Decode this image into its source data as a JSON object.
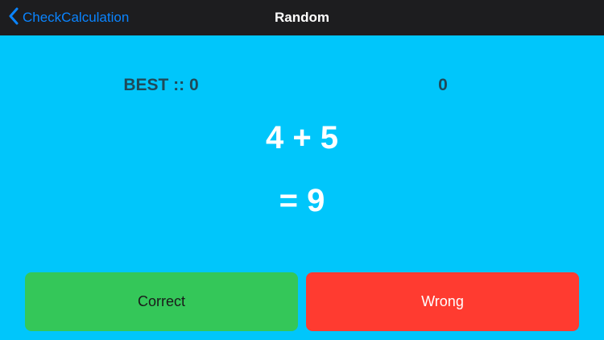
{
  "nav": {
    "back_label": "CheckCalculation",
    "title": "Random"
  },
  "score": {
    "best_label": "BEST :: 0",
    "current": "0"
  },
  "quiz": {
    "question": "4 + 5",
    "answer": "= 9"
  },
  "buttons": {
    "correct_label": "Correct",
    "wrong_label": "Wrong"
  },
  "colors": {
    "background": "#00c6fb",
    "navbar": "#1d1d1f",
    "link": "#0a84ff",
    "correct": "#34c759",
    "wrong": "#ff3b30",
    "score_text": "#1f4a59"
  },
  "icons": {
    "back": "chevron-left-icon"
  }
}
